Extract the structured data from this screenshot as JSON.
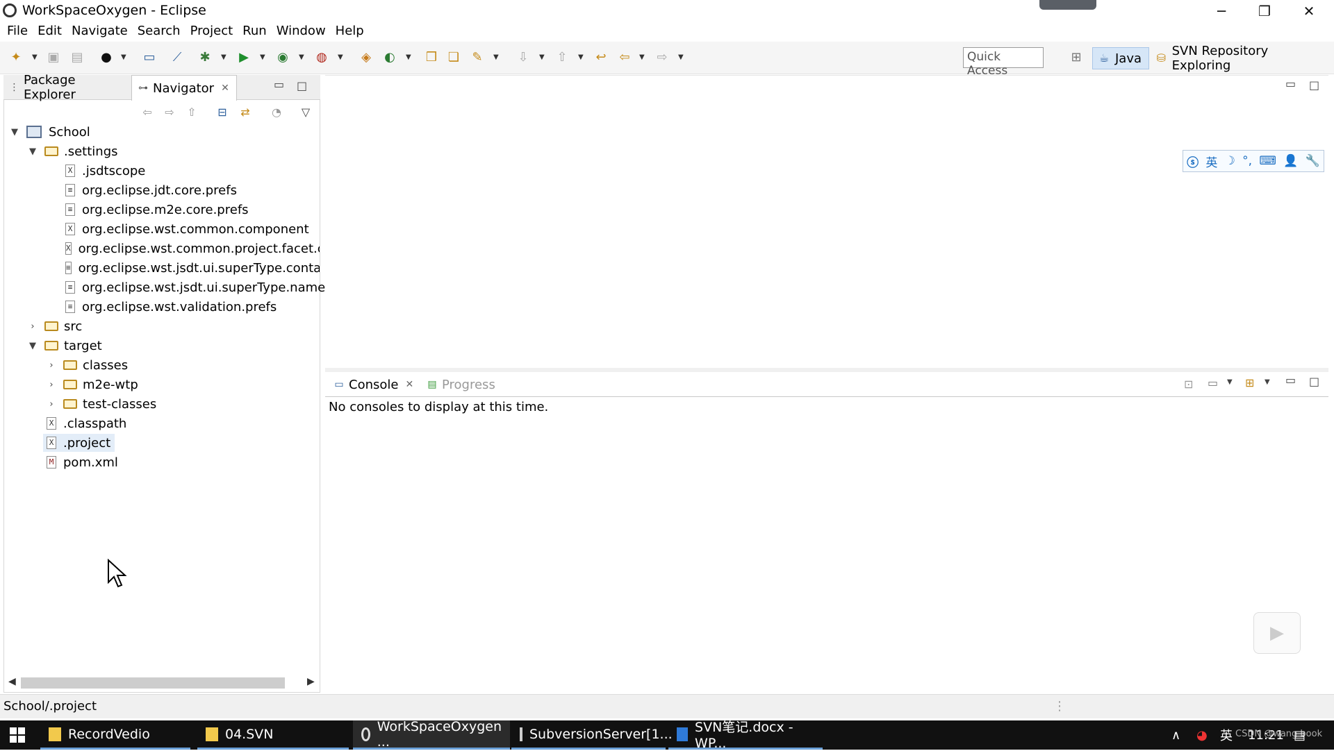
{
  "window": {
    "title": "WorkSpaceOxygen - Eclipse",
    "controls": {
      "minimize": "─",
      "restore": "❐",
      "close": "✕"
    }
  },
  "menu": [
    "File",
    "Edit",
    "Navigate",
    "Search",
    "Project",
    "Run",
    "Window",
    "Help"
  ],
  "toolbar": {
    "quick_access": "Quick Access",
    "perspectives": [
      {
        "label": "Java",
        "icon": "java-perspective-icon",
        "active": true
      },
      {
        "label": "SVN Repository Exploring",
        "icon": "svn-perspective-icon",
        "active": false
      }
    ]
  },
  "left_panel": {
    "tabs": [
      {
        "label": "Package Explorer",
        "icon": "package-explorer-icon",
        "active": false
      },
      {
        "label": "Navigator",
        "icon": "navigator-icon",
        "active": true
      }
    ],
    "tree": [
      {
        "label": "School",
        "type": "project",
        "expanded": true
      },
      {
        "label": ".settings",
        "type": "folder",
        "expanded": true
      },
      {
        "label": ".jsdtscope",
        "type": "xml"
      },
      {
        "label": "org.eclipse.jdt.core.prefs",
        "type": "file"
      },
      {
        "label": "org.eclipse.m2e.core.prefs",
        "type": "file"
      },
      {
        "label": "org.eclipse.wst.common.component",
        "type": "xml"
      },
      {
        "label": "org.eclipse.wst.common.project.facet.core",
        "type": "xml"
      },
      {
        "label": "org.eclipse.wst.jsdt.ui.superType.containe",
        "type": "file"
      },
      {
        "label": "org.eclipse.wst.jsdt.ui.superType.name",
        "type": "file"
      },
      {
        "label": "org.eclipse.wst.validation.prefs",
        "type": "file"
      },
      {
        "label": "src",
        "type": "folder",
        "expanded": false
      },
      {
        "label": "target",
        "type": "folder",
        "expanded": true
      },
      {
        "label": "classes",
        "type": "folder",
        "expanded": false
      },
      {
        "label": "m2e-wtp",
        "type": "folder",
        "expanded": false
      },
      {
        "label": "test-classes",
        "type": "folder",
        "expanded": false
      },
      {
        "label": ".classpath",
        "type": "xml"
      },
      {
        "label": ".project",
        "type": "xml",
        "selected": true
      },
      {
        "label": "pom.xml",
        "type": "maven"
      }
    ]
  },
  "console": {
    "tabs": [
      {
        "label": "Console",
        "icon": "console-icon",
        "active": true
      },
      {
        "label": "Progress",
        "icon": "progress-icon",
        "active": false
      }
    ],
    "message": "No consoles to display at this time."
  },
  "ime": {
    "items": [
      "英",
      "☽",
      "°,",
      "⌨",
      "👤",
      "🔧"
    ]
  },
  "status": {
    "text": "School/.project"
  },
  "taskbar": {
    "items": [
      {
        "label": "RecordVedio",
        "icon": "folder-icon"
      },
      {
        "label": "04.SVN",
        "icon": "folder-icon"
      },
      {
        "label": "WorkSpaceOxygen ...",
        "icon": "eclipse-icon",
        "active": true
      },
      {
        "label": "SubversionServer[1...",
        "icon": "server-icon"
      },
      {
        "label": "SVN笔记.docx - WP...",
        "icon": "wps-icon"
      }
    ],
    "tray": {
      "ime": "英",
      "time": "11:21",
      "watermark": "CSDN @wang book"
    }
  },
  "colors": {
    "selection": "#e3edf8",
    "java_active": "#d6e6f7",
    "taskbar": "#111111"
  }
}
